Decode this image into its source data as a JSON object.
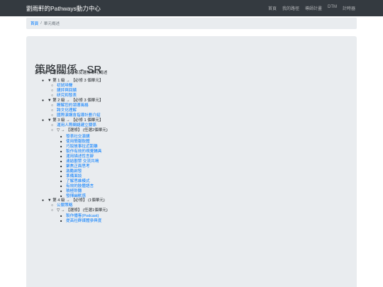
{
  "navbar": {
    "brand": "劉雨軒的Pathways動力中心",
    "links": [
      "首頁",
      "我的路徑",
      "導師計畫",
      "DTM",
      "計時器"
    ]
  },
  "breadcrumb": {
    "home": "首頁",
    "separator": "/",
    "current": "單元概述"
  },
  "page": {
    "title": "策略關係 - SR",
    "subtitle": "第 1 級 ~ 第 5 級 之必修及選修單元概述"
  },
  "tree": [
    {
      "level": 1,
      "text": "▼ 第 1 級 → 【必修 3 個單元】",
      "link": false
    },
    {
      "level": 2,
      "text": "初試啼聲",
      "link": true
    },
    {
      "level": 2,
      "text": "講評與回饋",
      "link": true
    },
    {
      "level": 2,
      "text": "研究和發表",
      "link": true
    },
    {
      "level": 1,
      "text": "▼ 第 2 級 → 【必修 3 個單元】",
      "link": false
    },
    {
      "level": 2,
      "text": "瞭解您的領導風格",
      "link": true
    },
    {
      "level": 2,
      "text": "跨文化理解",
      "link": true
    },
    {
      "level": 2,
      "text": "國際演講會指導計劃介紹",
      "link": true
    },
    {
      "level": 1,
      "text": "▼ 第 3 級 → 【必修 1 個單元】",
      "link": false
    },
    {
      "level": 2,
      "text": "運用人際網絡建立關係",
      "link": true
    },
    {
      "level": 2,
      "text": "▽ → 【選修】 (任選2個單元)",
      "link": false
    },
    {
      "level": 3,
      "text": "發表社交演講",
      "link": true
    },
    {
      "level": 3,
      "text": "使用簡報軟體",
      "link": true
    },
    {
      "level": 3,
      "text": "巧說故事拉近距離",
      "link": true
    },
    {
      "level": 3,
      "text": "製作有效的視覺輔具",
      "link": true
    },
    {
      "level": 3,
      "text": "運用描述性言辭",
      "link": true
    },
    {
      "level": 3,
      "text": "連結觀眾 交流共鳴",
      "link": true
    },
    {
      "level": 3,
      "text": "聚焦正面思考",
      "link": true
    },
    {
      "level": 3,
      "text": "激勵啟發",
      "link": true
    },
    {
      "level": 3,
      "text": "準備面談",
      "link": true
    },
    {
      "level": 3,
      "text": "了解思維模式",
      "link": true
    },
    {
      "level": 3,
      "text": "有效的肢體語言",
      "link": true
    },
    {
      "level": 3,
      "text": "積極聆聽",
      "link": true
    },
    {
      "level": 3,
      "text": "發揮幽默感",
      "link": true
    },
    {
      "level": 1,
      "text": "▼ 第 4 級 → 【必修】 (1個單元)",
      "link": false
    },
    {
      "level": 2,
      "text": "公關策略",
      "link": true
    },
    {
      "level": 2,
      "text": "▽ → 【選修】 (任選1個單元)",
      "link": false
    },
    {
      "level": 3,
      "text": "製作播客(Podcast)",
      "link": true
    },
    {
      "level": 3,
      "text": "提高社群媒體參與度",
      "link": true
    }
  ],
  "colors": {
    "navbar_bg": "#343a40",
    "link": "#007bff",
    "panel_bg": "#e9ecef"
  }
}
